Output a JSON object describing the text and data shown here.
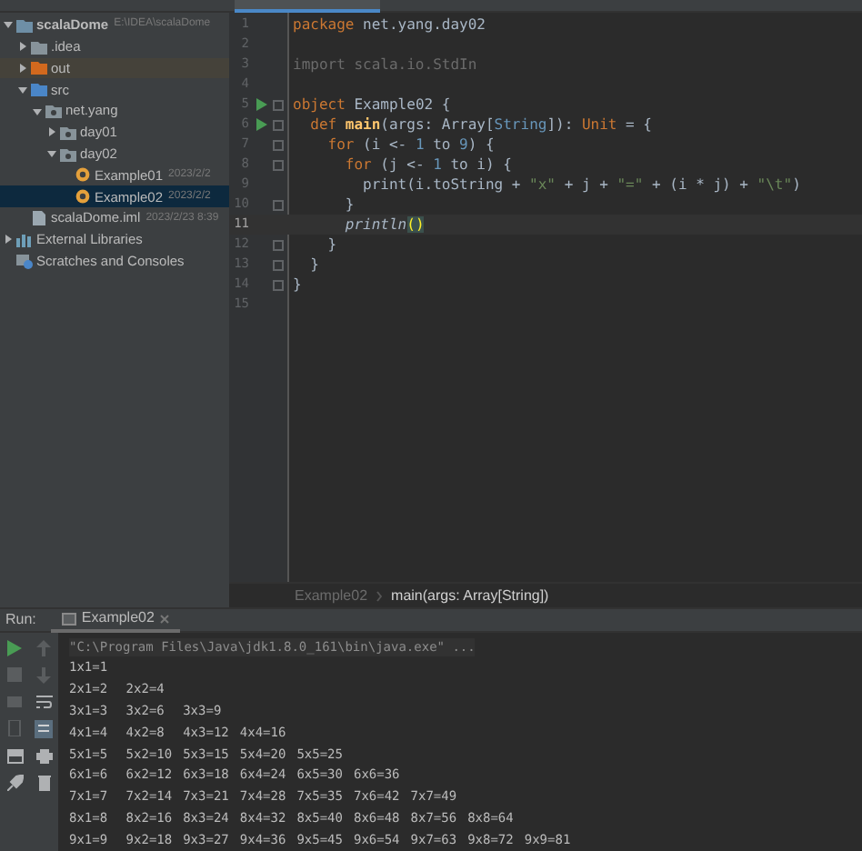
{
  "project_tree": [
    {
      "label": "scalaDome",
      "meta": "E:\\IDEA\\scalaDome",
      "kind": "module",
      "expanded": true,
      "selected": false,
      "children": [
        {
          "label": ".idea",
          "kind": "folder",
          "expanded": false,
          "selected": false
        },
        {
          "label": "out",
          "kind": "excluded",
          "expanded": false,
          "selected": false
        },
        {
          "label": "src",
          "kind": "source",
          "expanded": true,
          "selected": false,
          "children": [
            {
              "label": "net.yang",
              "kind": "package",
              "expanded": true,
              "selected": false,
              "children": [
                {
                  "label": "day01",
                  "kind": "package",
                  "expanded": false,
                  "selected": false
                },
                {
                  "label": "day02",
                  "kind": "package",
                  "expanded": true,
                  "selected": false,
                  "children": [
                    {
                      "label": "Example01",
                      "meta": "2023/2/2",
                      "kind": "object",
                      "selected": false
                    },
                    {
                      "label": "Example02",
                      "meta": "2023/2/2",
                      "kind": "object",
                      "selected": true
                    }
                  ]
                }
              ]
            }
          ]
        },
        {
          "label": "scalaDome.iml",
          "meta": "2023/2/23 8:39",
          "kind": "iml",
          "selected": false
        }
      ]
    },
    {
      "label": "External Libraries",
      "kind": "library",
      "expanded": false,
      "selected": false
    },
    {
      "label": "Scratches and Consoles",
      "kind": "scratch",
      "selected": false
    }
  ],
  "editor": {
    "lines": [
      {
        "number": "1",
        "run": false,
        "fold": false,
        "current": false,
        "tokens": [
          {
            "text": "package",
            "kind": "keyword"
          },
          {
            "text": " net.yang.day02",
            "kind": "plain"
          }
        ]
      },
      {
        "number": "2",
        "run": false,
        "fold": false,
        "current": false
      },
      {
        "number": "3",
        "run": false,
        "fold": false,
        "current": false,
        "tokens": [
          {
            "text": "import scala.io.StdIn",
            "kind": "unused"
          }
        ]
      },
      {
        "number": "4",
        "run": false,
        "fold": false,
        "current": false
      },
      {
        "number": "5",
        "run": true,
        "fold": true,
        "current": false,
        "tokens": [
          {
            "text": "object",
            "kind": "keyword"
          },
          {
            "text": " Example02 {",
            "kind": "plain"
          }
        ]
      },
      {
        "number": "6",
        "run": true,
        "fold": true,
        "current": false,
        "tokens": [
          {
            "text": "  def ",
            "kind": "keyword"
          },
          {
            "text": "main",
            "kind": "fn"
          },
          {
            "text": "(args: Array[",
            "kind": "plain"
          },
          {
            "text": "String",
            "kind": "type"
          },
          {
            "text": "]): ",
            "kind": "plain"
          },
          {
            "text": "Unit",
            "kind": "keyword"
          },
          {
            "text": " = {",
            "kind": "plain"
          }
        ]
      },
      {
        "number": "7",
        "run": false,
        "fold": true,
        "current": false,
        "tokens": [
          {
            "text": "    for",
            "kind": "keyword"
          },
          {
            "text": " (i <- ",
            "kind": "plain"
          },
          {
            "text": "1",
            "kind": "number"
          },
          {
            "text": " to ",
            "kind": "plain"
          },
          {
            "text": "9",
            "kind": "number"
          },
          {
            "text": ") {",
            "kind": "plain"
          }
        ]
      },
      {
        "number": "8",
        "run": false,
        "fold": true,
        "current": false,
        "tokens": [
          {
            "text": "      for",
            "kind": "keyword"
          },
          {
            "text": " (j <- ",
            "kind": "plain"
          },
          {
            "text": "1",
            "kind": "number"
          },
          {
            "text": " to i) {",
            "kind": "plain"
          }
        ]
      },
      {
        "number": "9",
        "run": false,
        "fold": false,
        "current": false,
        "tokens": [
          {
            "text": "        print(i.toString + ",
            "kind": "plain"
          },
          {
            "text": "\"x\"",
            "kind": "string"
          },
          {
            "text": " + j + ",
            "kind": "plain"
          },
          {
            "text": "\"=\"",
            "kind": "string"
          },
          {
            "text": " + (i * j) + ",
            "kind": "plain"
          },
          {
            "text": "\"\\t\"",
            "kind": "string"
          },
          {
            "text": ")",
            "kind": "plain"
          }
        ]
      },
      {
        "number": "10",
        "run": false,
        "fold": true,
        "current": false,
        "tokens": [
          {
            "text": "      }",
            "kind": "plain"
          }
        ]
      },
      {
        "number": "11",
        "run": false,
        "fold": false,
        "current": true,
        "tokens": [
          {
            "text": "      println",
            "kind": "italic"
          },
          {
            "text": "()",
            "kind": "match"
          }
        ]
      },
      {
        "number": "12",
        "run": false,
        "fold": true,
        "current": false,
        "tokens": [
          {
            "text": "    }",
            "kind": "plain"
          }
        ]
      },
      {
        "number": "13",
        "run": false,
        "fold": true,
        "current": false,
        "tokens": [
          {
            "text": "  }",
            "kind": "plain"
          }
        ]
      },
      {
        "number": "14",
        "run": false,
        "fold": true,
        "current": false,
        "tokens": [
          {
            "text": "}",
            "kind": "plain"
          }
        ]
      },
      {
        "number": "15",
        "run": false,
        "fold": false,
        "current": false
      }
    ],
    "breadcrumbs": [
      {
        "text": "Example02",
        "selected": false
      },
      {
        "text": "main(args: Array[String])",
        "selected": true
      }
    ]
  },
  "run_panel": {
    "label": "Run:",
    "tab": "Example02",
    "command": "\"C:\\Program Files\\Java\\jdk1.8.0_161\\bin\\java.exe\" ...",
    "output": [
      [
        "1x1=1"
      ],
      [
        "2x1=2",
        "2x2=4"
      ],
      [
        "3x1=3",
        "3x2=6",
        "3x3=9"
      ],
      [
        "4x1=4",
        "4x2=8",
        "4x3=12",
        "4x4=16"
      ],
      [
        "5x1=5",
        "5x2=10",
        "5x3=15",
        "5x4=20",
        "5x5=25"
      ],
      [
        "6x1=6",
        "6x2=12",
        "6x3=18",
        "6x4=24",
        "6x5=30",
        "6x6=36"
      ],
      [
        "7x1=7",
        "7x2=14",
        "7x3=21",
        "7x4=28",
        "7x5=35",
        "7x6=42",
        "7x7=49"
      ],
      [
        "8x1=8",
        "8x2=16",
        "8x3=24",
        "8x4=32",
        "8x5=40",
        "8x6=48",
        "8x7=56",
        "8x8=64"
      ],
      [
        "9x1=9",
        "9x2=18",
        "9x3=27",
        "9x4=36",
        "9x5=45",
        "9x6=54",
        "9x7=63",
        "9x8=72",
        "9x9=81"
      ]
    ]
  }
}
